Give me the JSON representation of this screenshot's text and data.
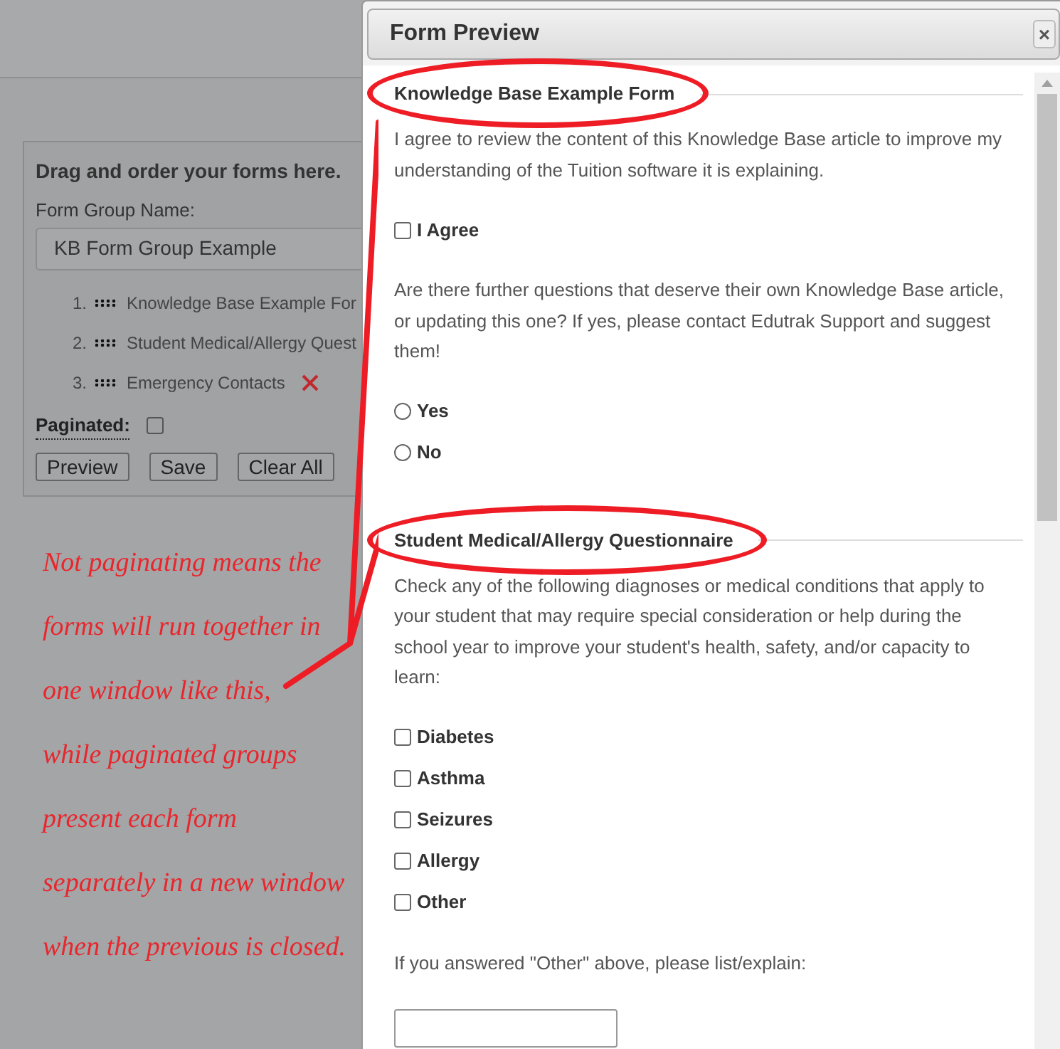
{
  "form_group_panel": {
    "title": "Drag and order your forms here.",
    "name_label": "Form Group Name:",
    "name_value": "KB Form Group Example",
    "forms": [
      {
        "number": "1.",
        "name": "Knowledge Base Example For",
        "removable": false
      },
      {
        "number": "2.",
        "name": "Student Medical/Allergy Quest",
        "removable": false
      },
      {
        "number": "3.",
        "name": "Emergency Contacts",
        "removable": true
      }
    ],
    "paginated_label": "Paginated:",
    "paginated": false,
    "buttons": [
      {
        "label": "Preview",
        "kind": "button"
      },
      {
        "label": "Save",
        "kind": "button"
      },
      {
        "label": "Clear All",
        "kind": "button"
      }
    ]
  },
  "annotation": {
    "lines": [
      "Not paginating means the",
      "forms will run together in",
      "one window like this,",
      "while paginated groups",
      "present each form",
      "separately in a new window",
      "when the previous is closed."
    ]
  },
  "dialog": {
    "title": "Form Preview",
    "close": "×",
    "sections": [
      {
        "heading": "Knowledge Base Example Form",
        "highlighted": true,
        "fields": [
          {
            "kind": "paragraph",
            "text": "I agree to review the content of this Knowledge Base article to improve my understanding of the Tuition software it is explaining."
          },
          {
            "kind": "checkbox",
            "label": "I Agree",
            "checked": false
          },
          {
            "kind": "paragraph",
            "text": "Are there further questions that deserve their own Knowledge Base article, or updating this one?  If yes, please contact Edutrak Support and suggest them!"
          },
          {
            "kind": "radio",
            "label": "Yes",
            "selected": false
          },
          {
            "kind": "radio",
            "label": "No",
            "selected": false
          }
        ]
      },
      {
        "heading": "Student Medical/Allergy Questionnaire",
        "highlighted": true,
        "fields": [
          {
            "kind": "paragraph",
            "text": "Check any of the following diagnoses or medical conditions that apply to your student that may require special consideration or help during the school year to improve your student's health, safety, and/or capacity to learn:"
          },
          {
            "kind": "checkbox",
            "label": "Diabetes",
            "checked": false
          },
          {
            "kind": "checkbox",
            "label": "Asthma",
            "checked": false
          },
          {
            "kind": "checkbox",
            "label": "Seizures",
            "checked": false
          },
          {
            "kind": "checkbox",
            "label": "Allergy",
            "checked": false
          },
          {
            "kind": "checkbox",
            "label": "Other",
            "checked": false
          },
          {
            "kind": "paragraph",
            "text": "If you answered \"Other\" above, please list/explain:"
          },
          {
            "kind": "textbox"
          }
        ]
      }
    ]
  }
}
